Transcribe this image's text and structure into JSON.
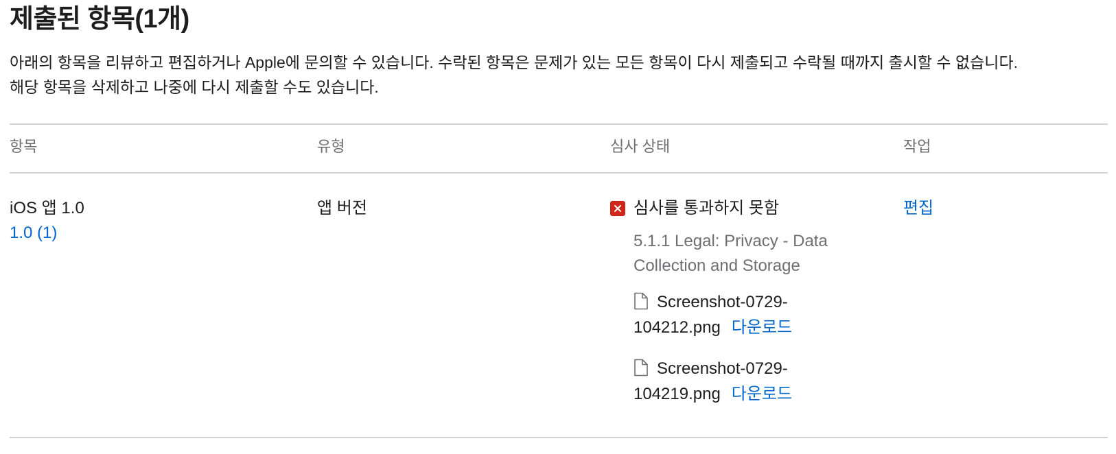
{
  "page": {
    "title": "제출된 항목(1개)",
    "description_line1": "아래의 항목을 리뷰하고 편집하거나 Apple에 문의할 수 있습니다. 수락된 항목은 문제가 있는 모든 항목이 다시 제출되고 수락될 때까지 출시할 수 없습니다.",
    "description_line2": "해당 항목을 삭제하고 나중에 다시 제출할 수도 있습니다."
  },
  "table": {
    "headers": {
      "item": "항목",
      "type": "유형",
      "review_status": "심사 상태",
      "action": "작업"
    },
    "rows": [
      {
        "item_name": "iOS 앱 1.0",
        "item_version": "1.0 (1)",
        "type": "앱 버전",
        "status": "심사를 통과하지 못함",
        "status_icon": "rejected-x-icon",
        "reason": "5.1.1 Legal: Privacy - Data Collection and Storage",
        "attachments": [
          {
            "file_line1": "Screenshot-0729-",
            "file_line2": "104212.png",
            "download_label": "다운로드"
          },
          {
            "file_line1": "Screenshot-0729-",
            "file_line2": "104219.png",
            "download_label": "다운로드"
          }
        ],
        "action_label": "편집"
      }
    ]
  },
  "colors": {
    "link": "#0066cc",
    "reject_red": "#d0271d",
    "muted": "#6e6e73",
    "rule": "#d2d2d7"
  }
}
